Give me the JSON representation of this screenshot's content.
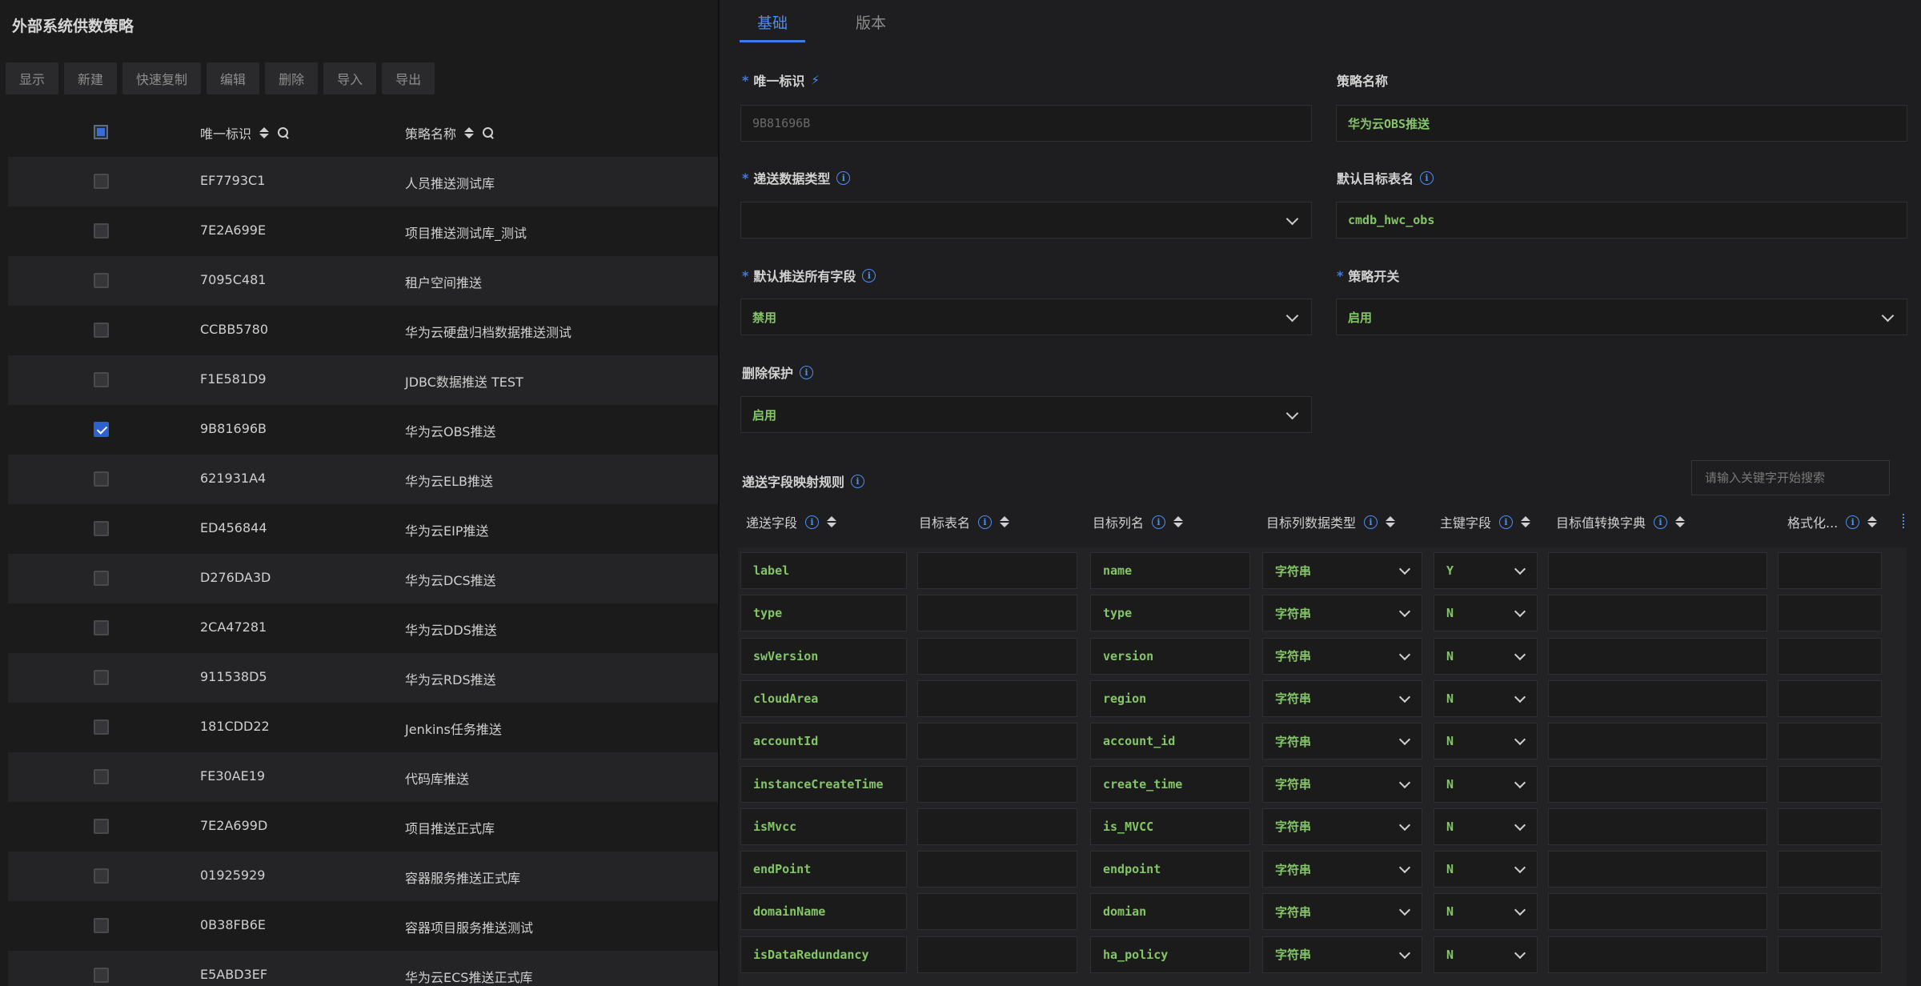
{
  "left": {
    "title": "外部系统供数策略",
    "toolbar": [
      "显示",
      "新建",
      "快速复制",
      "编辑",
      "删除",
      "导入",
      "导出"
    ],
    "columns": {
      "id": "唯一标识",
      "name": "策略名称"
    },
    "rows": [
      {
        "id": "EF7793C1",
        "name": "人员推送测试库",
        "checked": false
      },
      {
        "id": "7E2A699E",
        "name": "项目推送测试库_测试",
        "checked": false
      },
      {
        "id": "7095C481",
        "name": "租户空间推送",
        "checked": false
      },
      {
        "id": "CCBB5780",
        "name": "华为云硬盘归档数据推送测试",
        "checked": false
      },
      {
        "id": "F1E581D9",
        "name": "JDBC数据推送 TEST",
        "checked": false
      },
      {
        "id": "9B81696B",
        "name": "华为云OBS推送",
        "checked": true
      },
      {
        "id": "621931A4",
        "name": "华为云ELB推送",
        "checked": false
      },
      {
        "id": "ED456844",
        "name": "华为云EIP推送",
        "checked": false
      },
      {
        "id": "D276DA3D",
        "name": "华为云DCS推送",
        "checked": false
      },
      {
        "id": "2CA47281",
        "name": "华为云DDS推送",
        "checked": false
      },
      {
        "id": "911538D5",
        "name": "华为云RDS推送",
        "checked": false
      },
      {
        "id": "181CDD22",
        "name": "Jenkins任务推送",
        "checked": false
      },
      {
        "id": "FE30AE19",
        "name": "代码库推送",
        "checked": false
      },
      {
        "id": "7E2A699D",
        "name": "项目推送正式库",
        "checked": false
      },
      {
        "id": "01925929",
        "name": "容器服务推送正式库",
        "checked": false
      },
      {
        "id": "0B38FB6E",
        "name": "容器项目服务推送测试",
        "checked": false
      },
      {
        "id": "E5ABD3EF",
        "name": "华为云ECS推送正式库",
        "checked": false
      }
    ]
  },
  "right": {
    "tabs": [
      "基础",
      "版本"
    ],
    "fields": {
      "uid": {
        "label": "唯一标识",
        "value": "9B81696B"
      },
      "policy_name": {
        "label": "策略名称",
        "value": "华为云OBS推送"
      },
      "data_type": {
        "label": "递送数据类型",
        "value": ""
      },
      "default_table": {
        "label": "默认目标表名",
        "value": "cmdb_hwc_obs"
      },
      "push_all": {
        "label": "默认推送所有字段",
        "value": "禁用"
      },
      "switch": {
        "label": "策略开关",
        "value": "启用"
      },
      "delete_protect": {
        "label": "删除保护",
        "value": "启用"
      }
    },
    "mapping": {
      "title": "递送字段映射规则",
      "search_placeholder": "请输入关键字开始搜索",
      "columns": [
        "递送字段",
        "目标表名",
        "目标列名",
        "目标列数据类型",
        "主键字段",
        "目标值转换字典",
        "格式化..."
      ],
      "rows": [
        {
          "field": "label",
          "table": "",
          "column": "name",
          "type": "字符串",
          "pk": "Y"
        },
        {
          "field": "type",
          "table": "",
          "column": "type",
          "type": "字符串",
          "pk": "N"
        },
        {
          "field": "swVersion",
          "table": "",
          "column": "version",
          "type": "字符串",
          "pk": "N"
        },
        {
          "field": "cloudArea",
          "table": "",
          "column": "region",
          "type": "字符串",
          "pk": "N"
        },
        {
          "field": "accountId",
          "table": "",
          "column": "account_id",
          "type": "字符串",
          "pk": "N"
        },
        {
          "field": "instanceCreateTime",
          "table": "",
          "column": "create_time",
          "type": "字符串",
          "pk": "N"
        },
        {
          "field": "isMvcc",
          "table": "",
          "column": "is_MVCC",
          "type": "字符串",
          "pk": "N"
        },
        {
          "field": "endPoint",
          "table": "",
          "column": "endpoint",
          "type": "字符串",
          "pk": "N"
        },
        {
          "field": "domainName",
          "table": "",
          "column": "domian",
          "type": "字符串",
          "pk": "N"
        },
        {
          "field": "isDataRedundancy",
          "table": "",
          "column": "ha_policy",
          "type": "字符串",
          "pk": "N"
        }
      ]
    }
  },
  "colors": {
    "accent": "#3c7ce8",
    "value_green": "#84c566",
    "panel_bg": "#1e1e20"
  },
  "icons": [
    "search-icon",
    "sort-icon",
    "info-icon",
    "bolt-icon",
    "chevron-down-icon",
    "checkbox-icon"
  ]
}
